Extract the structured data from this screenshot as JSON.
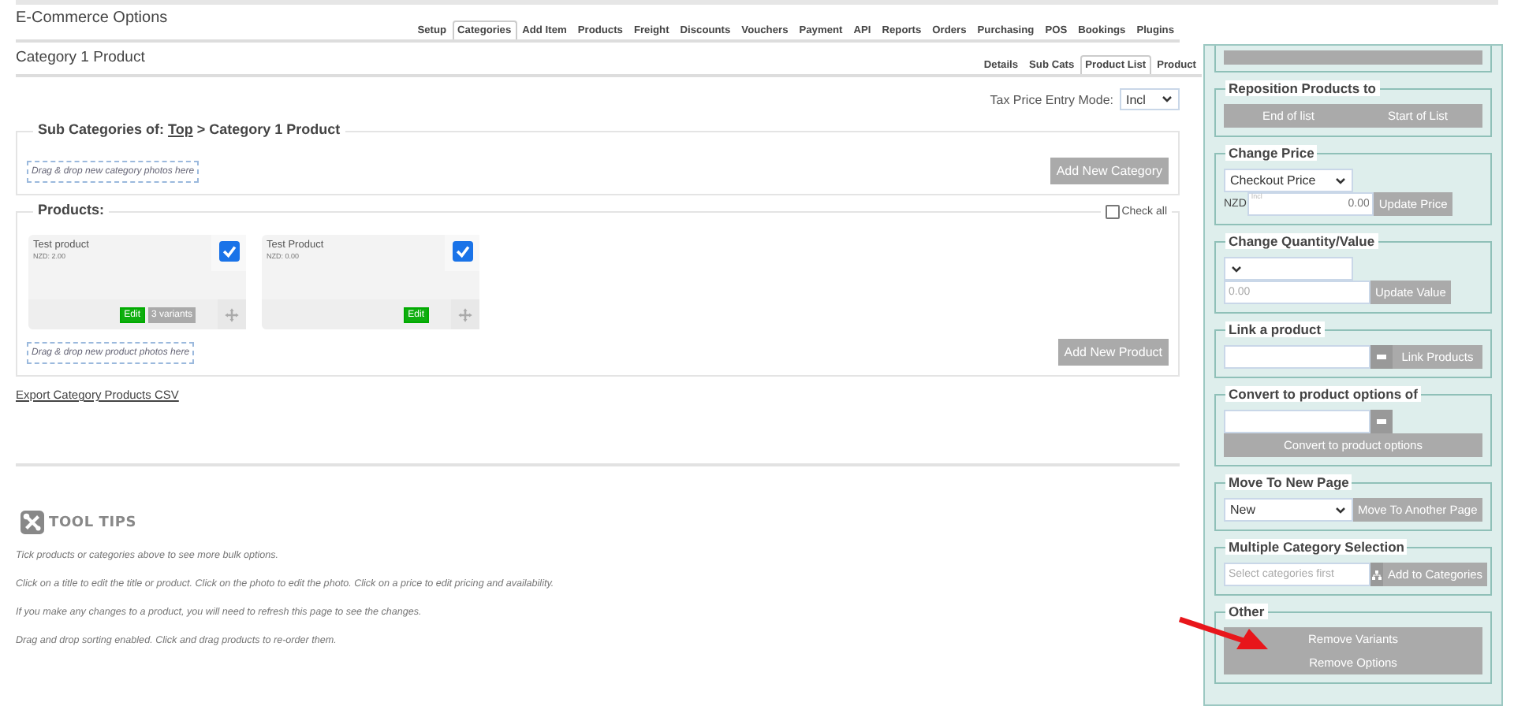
{
  "header": {
    "title": "E-Commerce Options"
  },
  "tabs": [
    {
      "label": "Setup",
      "selected": false
    },
    {
      "label": "Categories",
      "selected": true
    },
    {
      "label": "Add Item",
      "selected": false
    },
    {
      "label": "Products",
      "selected": false
    },
    {
      "label": "Freight",
      "selected": false
    },
    {
      "label": "Discounts",
      "selected": false
    },
    {
      "label": "Vouchers",
      "selected": false
    },
    {
      "label": "Payment",
      "selected": false
    },
    {
      "label": "API",
      "selected": false
    },
    {
      "label": "Reports",
      "selected": false
    },
    {
      "label": "Orders",
      "selected": false
    },
    {
      "label": "Purchasing",
      "selected": false
    },
    {
      "label": "POS",
      "selected": false
    },
    {
      "label": "Bookings",
      "selected": false
    },
    {
      "label": "Plugins",
      "selected": false
    }
  ],
  "page_title": "Category 1 Product",
  "sub_tabs": [
    {
      "label": "Details",
      "selected": false
    },
    {
      "label": "Sub Cats",
      "selected": false
    },
    {
      "label": "Product List",
      "selected": true
    },
    {
      "label": "Product",
      "selected": false
    }
  ],
  "tax_mode": {
    "label": "Tax Price Entry Mode:",
    "value": "Incl"
  },
  "sub_categories": {
    "legend": "Sub Categories of:",
    "link": "Top",
    "legend_rest": "> Category 1 Product",
    "drop_hint": "Drag & drop new category photos here",
    "button": "Add New Category"
  },
  "products": {
    "legend": "Products:",
    "check_all": {
      "label": "Check all",
      "checked": false
    },
    "items": [
      {
        "name": "Test product",
        "price": "NZD: 2.00",
        "checked": true,
        "buttons": [
          {
            "label": "Edit",
            "kind": "edit"
          },
          {
            "label": "3 variants",
            "kind": "variants"
          }
        ]
      },
      {
        "name": "Test Product",
        "price": "NZD: 0.00",
        "checked": true,
        "buttons": [
          {
            "label": "Edit",
            "kind": "edit"
          }
        ]
      }
    ],
    "drop_hint": "Drag & drop new product photos here",
    "button": "Add New Product"
  },
  "export_link": "Export Category Products CSV",
  "tool_tips": {
    "title": "TOOL TIPS",
    "lines": [
      "Tick products or categories above to see more bulk options.",
      "Click on a title to edit the title or product. Click on the photo to edit the photo. Click on a price to edit pricing and availability.",
      "If you make any changes to a product, you will need to refresh this page to see the changes.",
      "Drag and drop sorting enabled. Click and drag products to re-order them."
    ]
  },
  "bulk_panel": {
    "sections": [
      {
        "rows": [
          [
            {
              "kind": "covered_button"
            }
          ]
        ]
      },
      {
        "legend": "Reposition Products to",
        "rows": [
          [
            {
              "kind": "button",
              "label": "End of list",
              "grow": true
            },
            {
              "kind": "button",
              "label": "Start of List",
              "grow": true
            }
          ]
        ]
      },
      {
        "legend": "Change Price",
        "rows": [
          [
            {
              "kind": "select",
              "value": "Checkout Price"
            }
          ],
          [
            {
              "kind": "label",
              "text": "NZD"
            },
            {
              "kind": "input",
              "badge": "Incl",
              "value": "0.00"
            },
            {
              "kind": "button",
              "label": "Update Price"
            }
          ]
        ]
      },
      {
        "legend": "Change Quantity/Value",
        "rows": [
          [
            {
              "kind": "select"
            }
          ],
          [
            {
              "kind": "input",
              "placeholder": "0.00"
            },
            {
              "kind": "button",
              "label": "Update Value"
            }
          ]
        ]
      },
      {
        "legend": "Link a product",
        "rows": [
          [
            {
              "kind": "input"
            },
            {
              "kind": "picker"
            },
            {
              "kind": "button",
              "label": "Link Products",
              "grow": true
            }
          ]
        ]
      },
      {
        "legend": "Convert to product options of",
        "rows": [
          [
            {
              "kind": "input"
            },
            {
              "kind": "picker"
            }
          ],
          [
            {
              "kind": "button",
              "label": "Convert to product options",
              "grow": true
            }
          ]
        ]
      },
      {
        "legend": "Move To New Page",
        "rows": [
          [
            {
              "kind": "select",
              "value": "New"
            },
            {
              "kind": "button",
              "label": "Move To Another Page"
            }
          ]
        ]
      },
      {
        "legend": "Multiple Category Selection",
        "rows": [
          [
            {
              "kind": "input",
              "placeholder": "Select categories first"
            },
            {
              "kind": "tree_picker"
            },
            {
              "kind": "button",
              "label": "Add to Categories"
            }
          ]
        ]
      },
      {
        "legend": "Other",
        "rows": [
          [
            {
              "kind": "button",
              "label": "Remove Variants",
              "grow": true
            }
          ],
          [
            {
              "kind": "button",
              "label": "Remove Options",
              "grow": true
            }
          ]
        ]
      }
    ]
  }
}
